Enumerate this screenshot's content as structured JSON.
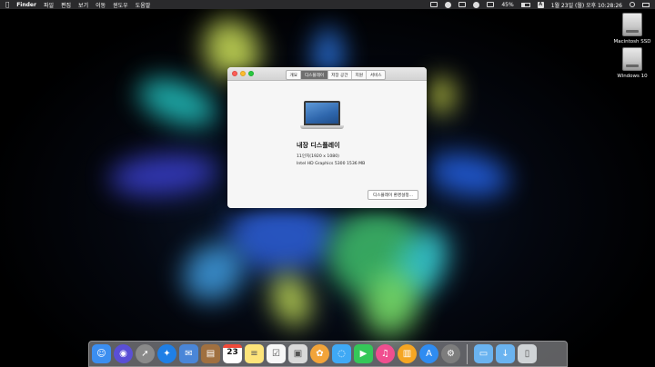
{
  "menubar": {
    "apple_icon": "apple-icon",
    "app_name": "Finder",
    "menus": [
      "파일",
      "편집",
      "보기",
      "이동",
      "윈도우",
      "도움말"
    ],
    "battery": "45%",
    "input_source": "A",
    "datetime": "1월 23일 (월) 오후 10:28:26"
  },
  "desktop": {
    "drives": [
      {
        "label": "Macintosh SSD"
      },
      {
        "label": "Windows 10"
      }
    ]
  },
  "window": {
    "tabs": [
      "개요",
      "디스플레이",
      "저장 공간",
      "지원",
      "서비스"
    ],
    "active_tab": "디스플레이",
    "display_name": "내장 디스플레이",
    "resolution": "11인치(1920 x 1080)",
    "graphics": "Intel HD Graphics 5300 1536 MB",
    "prefs_button": "디스플레이 환경설정..."
  },
  "dock": {
    "apps": [
      {
        "name": "finder-icon",
        "color": "#3b8ef0"
      },
      {
        "name": "siri-icon",
        "color": "#5a4fd6"
      },
      {
        "name": "launchpad-icon",
        "color": "#8a8a8a"
      },
      {
        "name": "safari-icon",
        "color": "#1f7fe6"
      },
      {
        "name": "mail-icon",
        "color": "#4a86d8"
      },
      {
        "name": "contacts-icon",
        "color": "#a07040"
      },
      {
        "name": "calendar-icon",
        "color": "#ffffff",
        "text": "23"
      },
      {
        "name": "notes-icon",
        "color": "#fde47a"
      },
      {
        "name": "reminders-icon",
        "color": "#f7f7f7"
      },
      {
        "name": "preview-icon",
        "color": "#d9d9d9"
      },
      {
        "name": "photos-icon",
        "color": "#f2a43a"
      },
      {
        "name": "messages-icon",
        "color": "#3fa9f5"
      },
      {
        "name": "facetime-icon",
        "color": "#35c759"
      },
      {
        "name": "itunes-icon",
        "color": "#f04f8f"
      },
      {
        "name": "ibooks-icon",
        "color": "#f5a623"
      },
      {
        "name": "app-store-icon",
        "color": "#2f8cf1"
      },
      {
        "name": "system-preferences-icon",
        "color": "#7d7d7d"
      },
      {
        "name": "applications-folder-icon",
        "color": "#6ab3f0"
      },
      {
        "name": "downloads-folder-icon",
        "color": "#6ab3f0"
      },
      {
        "name": "trash-icon",
        "color": "#cfd3d6"
      }
    ]
  }
}
